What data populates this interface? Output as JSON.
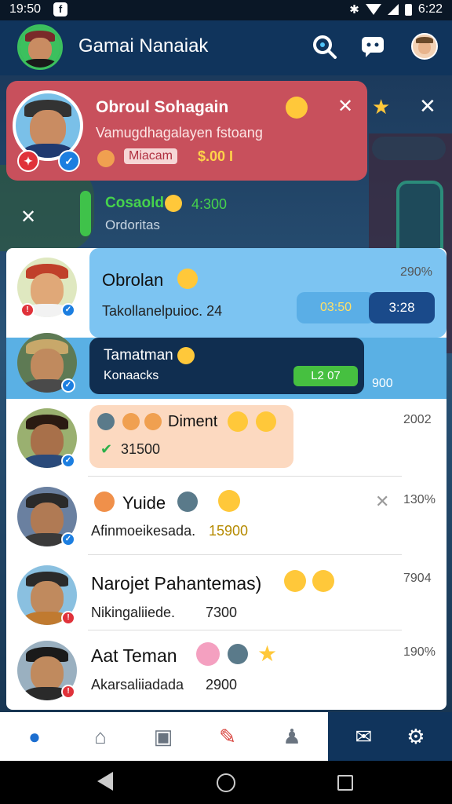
{
  "status_bar": {
    "time": "19:50",
    "clock_right": "6:22"
  },
  "header": {
    "title": "Gamai Nanaiak"
  },
  "notification": {
    "title": "Obroul Sohagain",
    "subtitle": "Vamugdhagalayen fstoang",
    "tag": "Miacam",
    "amount": "$.00 I"
  },
  "notification2": {
    "title": "Cosaold",
    "time": "4:300",
    "subtitle": "Ordoritas"
  },
  "chats": [
    {
      "name": "Obrolan",
      "message": "Takollanelpuioc. 24",
      "time": "290%",
      "pill1": "03:50",
      "pill2": "3:28"
    },
    {
      "name": "Tamatman",
      "message": "Konaacks",
      "time": "900",
      "pill": "L2 07"
    },
    {
      "name": "Diment",
      "message": "31500",
      "time": "2002"
    },
    {
      "name": "Yuide",
      "message": "Afinmoeikesada.",
      "amount": "15900",
      "time": "130%"
    },
    {
      "name": "Narojet Pahantemas)",
      "message": "Nikingaliiede.",
      "amount": "7300",
      "time": "7904"
    },
    {
      "name": "Aat Teman",
      "message": "Akarsaliiadada",
      "amount": "2900",
      "time": "190%"
    }
  ]
}
